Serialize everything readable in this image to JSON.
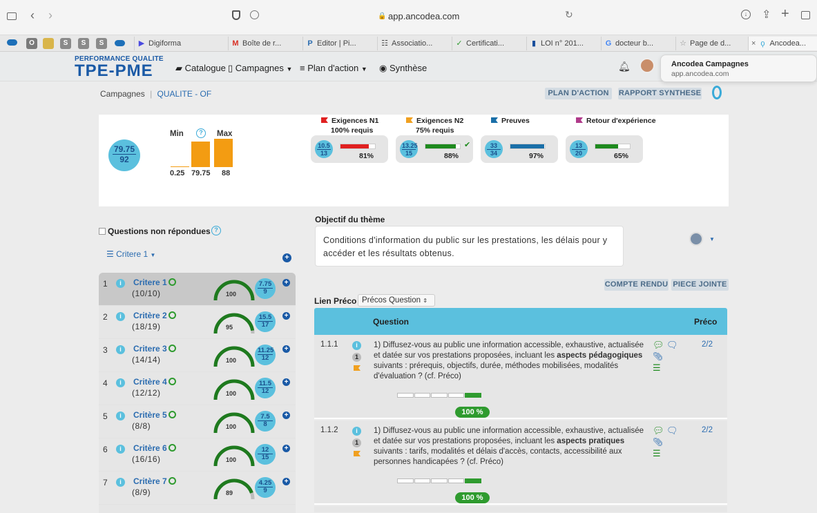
{
  "browser": {
    "url": "app.ancodea.com",
    "tabs": [
      {
        "label": "Digiforma"
      },
      {
        "label": "Boîte de r..."
      },
      {
        "label": "Editor | Pi..."
      },
      {
        "label": "Associatio..."
      },
      {
        "label": "Certificati..."
      },
      {
        "label": "LOI n° 201..."
      },
      {
        "label": "docteur b..."
      },
      {
        "label": "Page de d..."
      },
      {
        "label": "Ancodea..."
      }
    ],
    "pinned": [
      "O",
      "S",
      "S",
      "S"
    ]
  },
  "header": {
    "logo_top": "PERFORMANCE QUALITE",
    "logo_main": "TPE-PME",
    "nav": {
      "catalogue": "Catalogue",
      "campagnes": "Campagnes",
      "plan": "Plan d'action",
      "synthese": "Synthèse"
    }
  },
  "notification": {
    "title": "Ancodea Campagnes",
    "subtitle": "app.ancodea.com"
  },
  "breadcrumb": {
    "root": "Campagnes",
    "sep": "|",
    "current": "QUALITE - OF"
  },
  "actions": {
    "plan": "PLAN D'ACTION",
    "rapport": "RAPPORT SYNTHESE",
    "compte_rendu": "COMPTE RENDU",
    "piece_jointe": "PIECE JOINTE"
  },
  "summary": {
    "score_num": "79.75",
    "score_den": "92",
    "min_label": "Min",
    "max_label": "Max",
    "help": "?",
    "bars": [
      {
        "label": "0.25",
        "value": 0.25
      },
      {
        "label": "79.75",
        "value": 79.75
      },
      {
        "label": "88",
        "value": 88
      }
    ],
    "bars_max": 92,
    "indicators": [
      {
        "title": "Exigences N1",
        "sub": "100% requis",
        "flag_color": "#e02020",
        "num": "10.5",
        "den": "13",
        "pct": "81%",
        "fill": 0.81,
        "bar_color": "#e02020",
        "check": ""
      },
      {
        "title": "Exigences N2",
        "sub": "75% requis",
        "flag_color": "#f0a020",
        "num": "13.25",
        "den": "15",
        "pct": "88%",
        "fill": 0.88,
        "bar_color": "#1e8a1e",
        "check": "✔"
      },
      {
        "title": "Preuves",
        "sub": "",
        "flag_color": "#1a6fa8",
        "num": "33",
        "den": "34",
        "pct": "97%",
        "fill": 0.97,
        "bar_color": "#1a6fa8",
        "check": ""
      },
      {
        "title": "Retour d'expérience",
        "sub": "",
        "flag_color": "#b03a8a",
        "num": "13",
        "den": "20",
        "pct": "65%",
        "fill": 0.65,
        "bar_color": "#1e8a1e",
        "check": ""
      }
    ]
  },
  "left": {
    "unanswered_label": "Questions non répondues",
    "help": "?",
    "filter_label": "Critere 1",
    "criteria": [
      {
        "idx": "1",
        "name": "Critere 1",
        "count": "(10/10)",
        "gauge": "100",
        "gauge_fill": 1.0,
        "num": "7.75",
        "den": "9"
      },
      {
        "idx": "2",
        "name": "Critère 2",
        "count": "(18/19)",
        "gauge": "95",
        "gauge_fill": 0.95,
        "num": "15.5",
        "den": "17"
      },
      {
        "idx": "3",
        "name": "Critere 3",
        "count": "(14/14)",
        "gauge": "100",
        "gauge_fill": 1.0,
        "num": "11.25",
        "den": "12"
      },
      {
        "idx": "4",
        "name": "Critère 4",
        "count": "(12/12)",
        "gauge": "100",
        "gauge_fill": 1.0,
        "num": "11.5",
        "den": "12"
      },
      {
        "idx": "5",
        "name": "Critère 5",
        "count": "(8/8)",
        "gauge": "100",
        "gauge_fill": 1.0,
        "num": "7.5",
        "den": "8"
      },
      {
        "idx": "6",
        "name": "Critère 6",
        "count": "(16/16)",
        "gauge": "100",
        "gauge_fill": 1.0,
        "num": "12",
        "den": "15"
      },
      {
        "idx": "7",
        "name": "Critère 7",
        "count": "(8/9)",
        "gauge": "89",
        "gauge_fill": 0.89,
        "num": "4.25",
        "den": "9"
      }
    ]
  },
  "theme": {
    "objective_label": "Objectif du thème",
    "objective_text": "Conditions d'information du public sur les prestations, les délais pour y accéder et les résultats obtenus.",
    "lien_preco_label": "Lien Préco",
    "lien_preco_value": "Précos Question",
    "table_header_question": "Question",
    "table_header_preco": "Préco"
  },
  "questions": [
    {
      "num": "1.1.1",
      "badge": "1",
      "text_before": "1) Diffusez-vous au public une information accessible, exhaustive, actualisée et datée sur vos prestations proposées, incluant les ",
      "text_bold": "aspects pédagogiques",
      "text_after": " suivants : prérequis, objectifs, durée, méthodes mobilisées, modalités d'évaluation ? (cf. Préco)",
      "preco": "2/2",
      "pct": "100 %",
      "segments_on": 1
    },
    {
      "num": "1.1.2",
      "badge": "1",
      "text_before": "1) Diffusez-vous au public une information accessible, exhaustive, actualisée et datée sur vos prestations proposées, incluant les ",
      "text_bold": "aspects pratiques",
      "text_after": " suivants : tarifs, modalités et délais d'accès, contacts, accessibilité aux personnes handicapées ? (cf. Préco)",
      "preco": "2/2",
      "pct": "100 %",
      "segments_on": 1
    }
  ]
}
